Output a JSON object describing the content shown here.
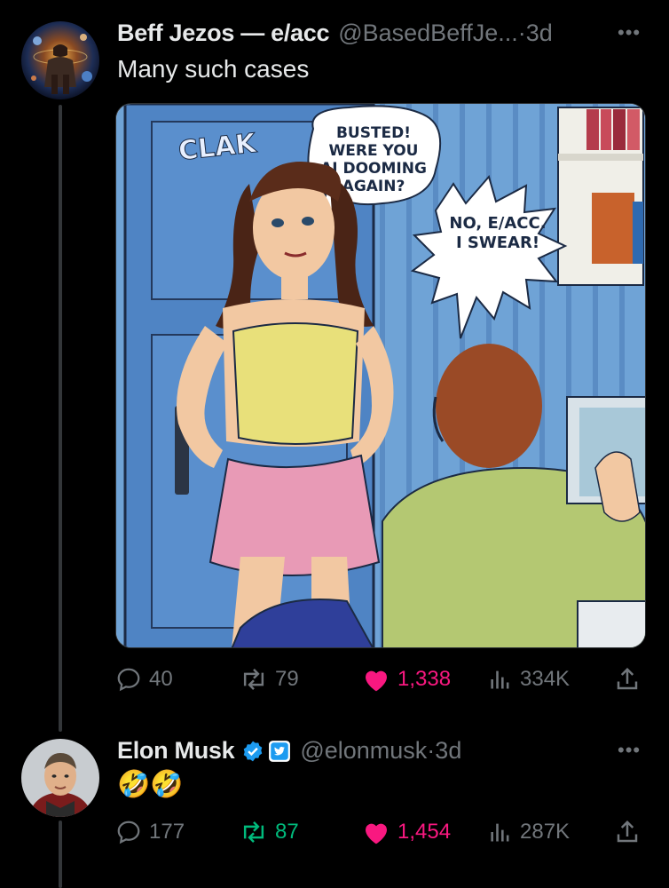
{
  "post1": {
    "author_name": "Beff Jezos — e/acc",
    "handle": "@BasedBeffJe...",
    "time": "3d",
    "text": "Many such cases",
    "more_icon": "more-dots-icon",
    "comic": {
      "sound_effect": "CLAK",
      "bubble_girl": [
        "BUSTED!",
        "WERE YOU",
        "AI DOOMING",
        "AGAIN?"
      ],
      "bubble_boy": [
        "NO, E/ACC.",
        "I SWEAR!"
      ]
    },
    "actions": {
      "replies": "40",
      "reposts": "79",
      "likes": "1,338",
      "views": "334K"
    }
  },
  "post2": {
    "author_name": "Elon Musk",
    "handle": "@elonmusk",
    "time": "3d",
    "text": "🤣🤣",
    "verified_icon": "verified-badge-icon",
    "affiliate_icon": "twitter-bird-badge-icon",
    "actions": {
      "replies": "177",
      "reposts": "87",
      "likes": "1,454",
      "views": "287K"
    }
  },
  "colors": {
    "background": "#000000",
    "text": "#e7e9ea",
    "muted": "#71767b",
    "like": "#f91880",
    "repost": "#00ba7c",
    "verified": "#1d9bf0"
  }
}
